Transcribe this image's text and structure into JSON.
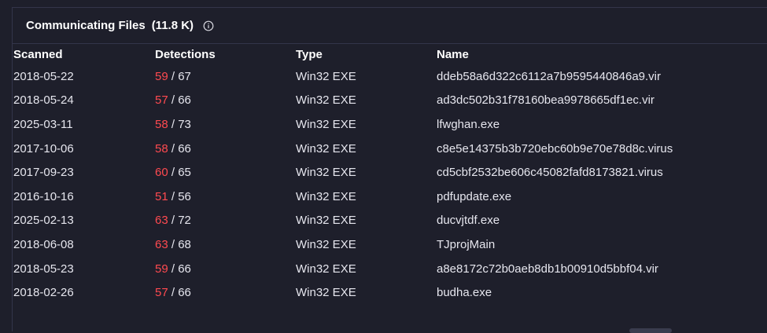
{
  "panel": {
    "title": "Communicating Files",
    "count": "(11.8 K)",
    "info_icon": "info-circle-icon"
  },
  "table": {
    "headers": {
      "scanned": "Scanned",
      "detections": "Detections",
      "type": "Type",
      "name": "Name"
    },
    "rows": [
      {
        "scanned": "2018-05-22",
        "detected": "59",
        "total": "/ 67",
        "type": "Win32 EXE",
        "name": "ddeb58a6d322c6112a7b9595440846a9.vir"
      },
      {
        "scanned": "2018-05-24",
        "detected": "57",
        "total": "/ 66",
        "type": "Win32 EXE",
        "name": "ad3dc502b31f78160bea9978665df1ec.vir"
      },
      {
        "scanned": "2025-03-11",
        "detected": "58",
        "total": "/ 73",
        "type": "Win32 EXE",
        "name": "lfwghan.exe"
      },
      {
        "scanned": "2017-10-06",
        "detected": "58",
        "total": "/ 66",
        "type": "Win32 EXE",
        "name": "c8e5e14375b3b720ebc60b9e70e78d8c.virus"
      },
      {
        "scanned": "2017-09-23",
        "detected": "60",
        "total": "/ 65",
        "type": "Win32 EXE",
        "name": "cd5cbf2532be606c45082fafd8173821.virus"
      },
      {
        "scanned": "2016-10-16",
        "detected": "51",
        "total": "/ 56",
        "type": "Win32 EXE",
        "name": "pdfupdate.exe"
      },
      {
        "scanned": "2025-02-13",
        "detected": "63",
        "total": "/ 72",
        "type": "Win32 EXE",
        "name": "ducvjtdf.exe"
      },
      {
        "scanned": "2018-06-08",
        "detected": "63",
        "total": "/ 68",
        "type": "Win32 EXE",
        "name": "TJprojMain"
      },
      {
        "scanned": "2018-05-23",
        "detected": "59",
        "total": "/ 66",
        "type": "Win32 EXE",
        "name": "a8e8172c72b0aeb8db1b00910d5bbf04.vir"
      },
      {
        "scanned": "2018-02-26",
        "detected": "57",
        "total": "/ 66",
        "type": "Win32 EXE",
        "name": "budha.exe"
      }
    ]
  },
  "colors": {
    "background": "#1e1f2b",
    "detection_red": "#ff4a50",
    "text": "#e6e6ee",
    "border": "#33354a"
  }
}
